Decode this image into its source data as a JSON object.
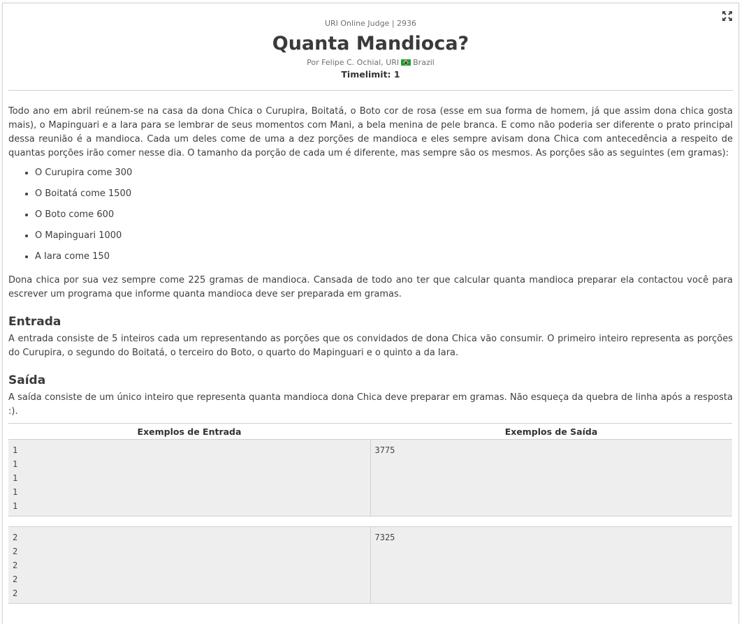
{
  "header": {
    "judge_label": "URI Online Judge | 2936",
    "title": "Quanta Mandioca?",
    "author_prefix": "Por Felipe C. Ochial, URI",
    "country": "Brazil",
    "timelimit": "Timelimit: 1"
  },
  "icons": {
    "expand": "expand-icon",
    "flag": "brazil-flag-icon"
  },
  "description": {
    "paragraph1": "Todo ano em abril reúnem-se na casa da dona Chica o Curupira, Boitatá, o Boto cor de rosa (esse em sua forma de homem, já que assim dona chica gosta mais), o Mapinguari e a Iara para se lembrar de seus momentos com Mani, a bela menina de pele branca. E como não poderia ser diferente o prato principal dessa reunião é a mandioca. Cada um deles come de uma a dez porções de mandioca e eles sempre avisam dona Chica com antecedência a respeito de quantas porções irão comer nesse dia. O tamanho da porção de cada um é diferente, mas sempre são os mesmos. As porções são as seguintes (em gramas):",
    "items": [
      "O Curupira come 300",
      "O Boitatá come 1500",
      "O Boto come 600",
      "O Mapinguari 1000",
      "A Iara come 150"
    ],
    "paragraph2": "Dona chica por sua vez sempre come 225 gramas de mandioca. Cansada de todo ano ter que calcular quanta mandioca preparar ela contactou você para escrever um programa que informe quanta mandioca deve ser preparada em gramas."
  },
  "input_section": {
    "heading": "Entrada",
    "text": "A entrada consiste de 5 inteiros cada um representando as porções que os convidados de dona Chica vão consumir. O primeiro inteiro representa as porções do Curupira, o segundo do Boitatá, o terceiro do Boto, o quarto do Mapinguari e o quinto a da Iara."
  },
  "output_section": {
    "heading": "Saída",
    "text": "A saída consiste de um único inteiro que representa quanta mandioca dona Chica deve preparar em gramas. Não esqueça da quebra de linha após a resposta :)."
  },
  "examples": {
    "input_header": "Exemplos de Entrada",
    "output_header": "Exemplos de Saída",
    "cases": [
      {
        "input": [
          "1",
          "1",
          "1",
          "1",
          "1"
        ],
        "output": "3775"
      },
      {
        "input": [
          "2",
          "2",
          "2",
          "2",
          "2"
        ],
        "output": "7325"
      }
    ]
  }
}
